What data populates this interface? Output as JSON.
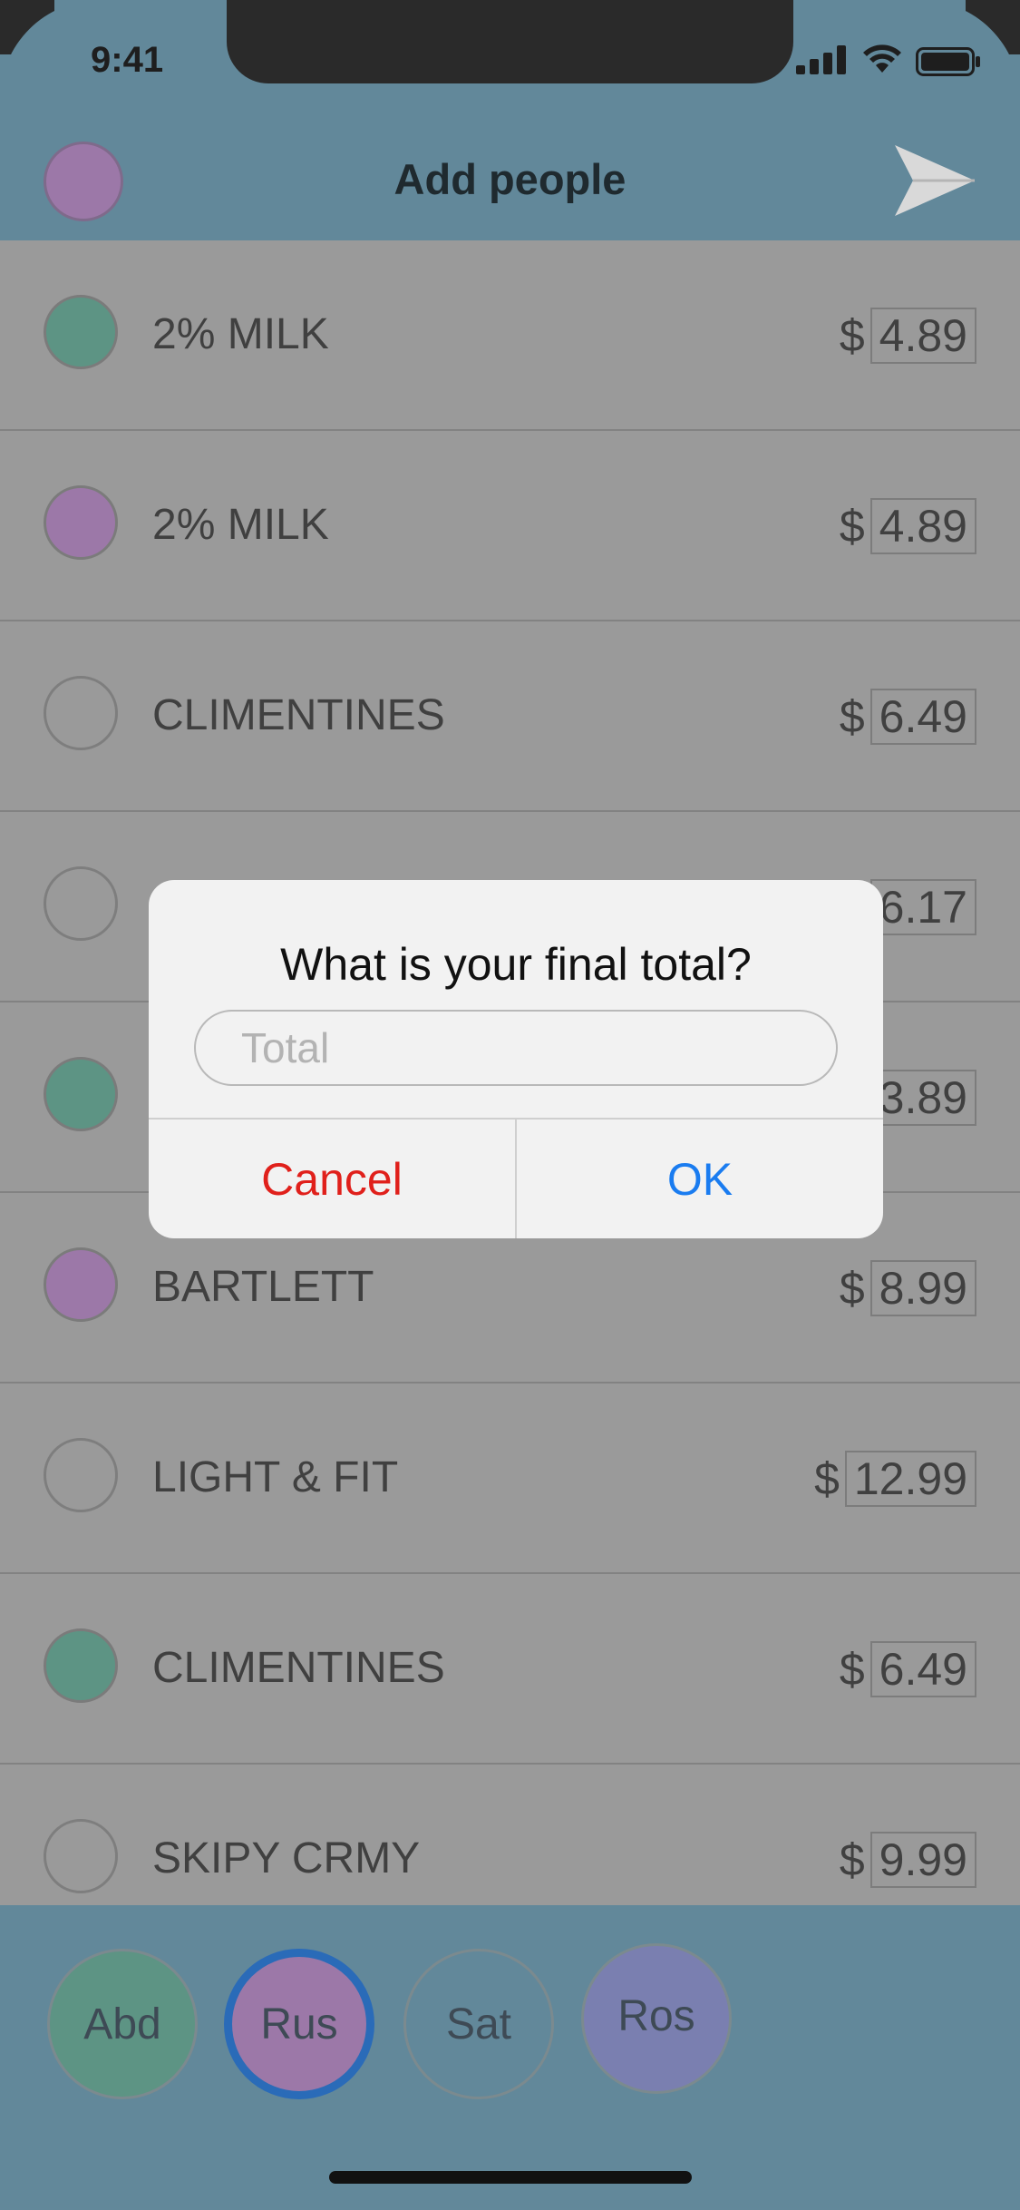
{
  "status_bar": {
    "time": "9:41"
  },
  "nav": {
    "title": "Add people",
    "avatar_color": "#9c78a8"
  },
  "items": [
    {
      "name": "2% MILK",
      "currency": "$",
      "price": "4.89",
      "dot_color": "#5d9484"
    },
    {
      "name": "2% MILK",
      "currency": "$",
      "price": "4.89",
      "dot_color": "#9c78a8"
    },
    {
      "name": "CLIMENTINES",
      "currency": "$",
      "price": "6.49",
      "dot_color": ""
    },
    {
      "name": "",
      "currency": "$",
      "price": "6.17",
      "dot_color": ""
    },
    {
      "name": "",
      "currency": "$",
      "price": "3.89",
      "dot_color": "#5d9484"
    },
    {
      "name": "BARTLETT",
      "currency": "$",
      "price": "8.99",
      "dot_color": "#9c78a8"
    },
    {
      "name": "LIGHT & FIT",
      "currency": "$",
      "price": "12.99",
      "dot_color": ""
    },
    {
      "name": "CLIMENTINES",
      "currency": "$",
      "price": "6.49",
      "dot_color": "#5d9484"
    },
    {
      "name": "SKIPY CRMY",
      "currency": "$",
      "price": "9.99",
      "dot_color": ""
    }
  ],
  "people": [
    {
      "label": "Abd",
      "color": "#5d9484",
      "selected": false
    },
    {
      "label": "Rus",
      "color": "#9c78a8",
      "selected": true
    },
    {
      "label": "Sat",
      "color": "#62889a",
      "selected": false
    },
    {
      "label": "Ros",
      "color": "#7a7fb0",
      "selected": false
    }
  ],
  "alert": {
    "title": "What is your final total?",
    "input_placeholder": "Total",
    "input_value": "",
    "cancel_label": "Cancel",
    "ok_label": "OK",
    "cancel_color": "#e0201b",
    "ok_color": "#1a7cf0"
  }
}
